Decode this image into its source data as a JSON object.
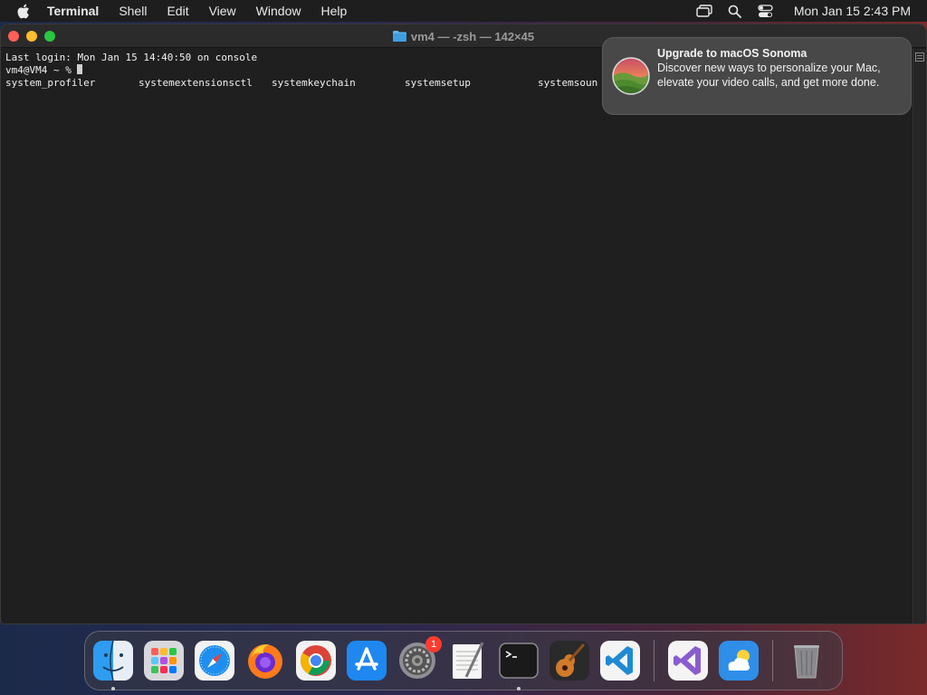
{
  "menubar": {
    "app_name": "Terminal",
    "menus": [
      "Shell",
      "Edit",
      "View",
      "Window",
      "Help"
    ],
    "clock": "Mon Jan 15  2:43 PM",
    "status_icons": [
      "screen-mirroring-icon",
      "search-icon",
      "control-center-icon"
    ]
  },
  "window": {
    "title": "vm4 — -zsh — 142×45",
    "last_login": "Last login: Mon Jan 15 14:40:50 on console",
    "prompt": "vm4@VM4 ~ % ",
    "completions": [
      "system_profiler",
      "systemextensionsctl",
      "systemkeychain",
      "systemsetup",
      "systemsoun"
    ]
  },
  "notification": {
    "title": "Upgrade to macOS Sonoma",
    "body": "Discover new ways to personalize your Mac, elevate your video calls, and get more done."
  },
  "dock": {
    "apps": [
      {
        "name": "Finder",
        "icon": "finder-icon",
        "running": true
      },
      {
        "name": "Launchpad",
        "icon": "launchpad-icon",
        "running": false
      },
      {
        "name": "Safari",
        "icon": "safari-icon",
        "running": false
      },
      {
        "name": "Firefox",
        "icon": "firefox-icon",
        "running": false
      },
      {
        "name": "Google Chrome",
        "icon": "chrome-icon",
        "running": false
      },
      {
        "name": "App Store",
        "icon": "app-store-icon",
        "running": false
      },
      {
        "name": "System Settings",
        "icon": "system-settings-icon",
        "running": false,
        "badge": "1"
      },
      {
        "name": "TextEdit",
        "icon": "textedit-icon",
        "running": false
      },
      {
        "name": "Terminal",
        "icon": "terminal-icon",
        "running": true
      },
      {
        "name": "GarageBand",
        "icon": "garageband-icon",
        "running": false
      },
      {
        "name": "Visual Studio Code",
        "icon": "vscode-icon",
        "running": false
      },
      {
        "name": "Visual Studio",
        "icon": "visual-studio-icon",
        "running": false
      },
      {
        "name": "Weather",
        "icon": "weather-icon",
        "running": false
      },
      {
        "name": "Trash",
        "icon": "trash-icon",
        "running": false
      }
    ]
  }
}
